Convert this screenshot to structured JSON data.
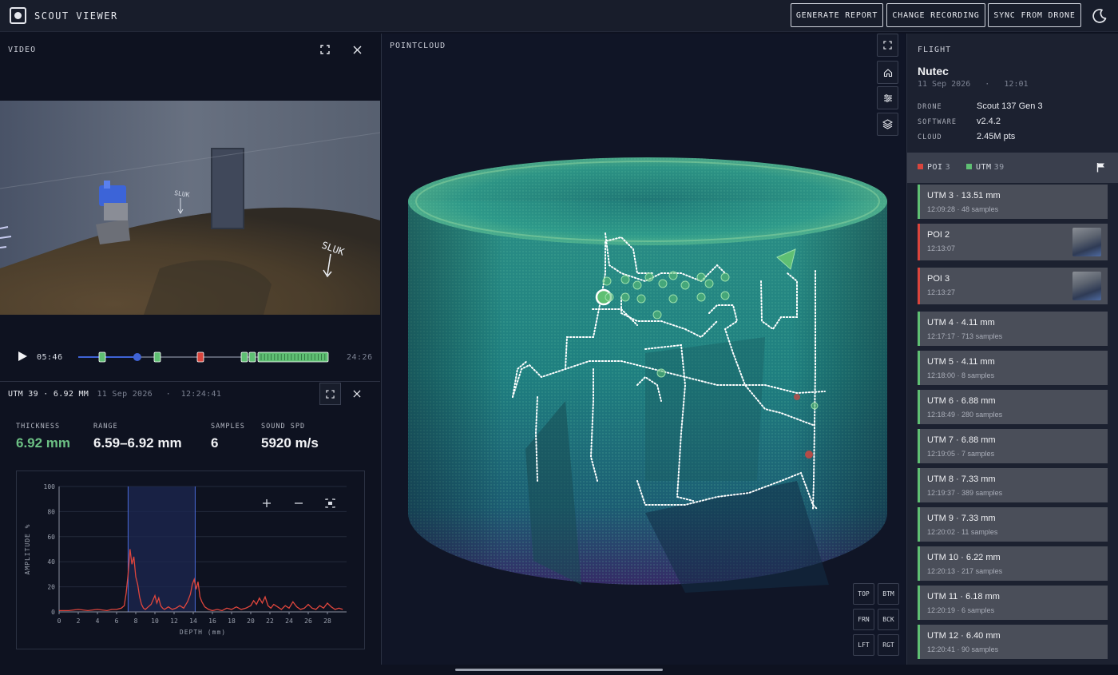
{
  "app": {
    "title": "SCOUT VIEWER"
  },
  "topbar": {
    "generate_report": "GENERATE REPORT",
    "change_recording": "CHANGE RECORDING",
    "sync_from_drone": "SYNC FROM DRONE"
  },
  "video": {
    "label": "VIDEO",
    "current_time": "05:46",
    "duration": "24:26",
    "progress": 0.236,
    "frame_text": [
      "SLUK",
      "SLUK"
    ]
  },
  "detail": {
    "title": "UTM 39 · 6.92 MM",
    "date": "11 Sep 2026",
    "time": "12:24:41",
    "stats": [
      {
        "label": "THICKNESS",
        "value": "6.92 mm"
      },
      {
        "label": "RANGE",
        "value": "6.59–6.92 mm"
      },
      {
        "label": "SAMPLES",
        "value": "6"
      },
      {
        "label": "SOUND SPD",
        "value": "5920 m/s"
      }
    ]
  },
  "pointcloud": {
    "label": "POINTCLOUD",
    "views": [
      "TOP",
      "BTM",
      "FRN",
      "BCK",
      "LFT",
      "RGT"
    ]
  },
  "flight": {
    "label": "FLIGHT",
    "name": "Nutec",
    "date": "11 Sep 2026",
    "time": "12:01",
    "info": [
      {
        "key": "DRONE",
        "value": "Scout 137 Gen 3"
      },
      {
        "key": "SOFTWARE",
        "value": "v2.4.2"
      },
      {
        "key": "CLOUD",
        "value": "2.45M pts"
      }
    ],
    "legend": {
      "poi_label": "POI",
      "poi_count": "3",
      "utm_label": "UTM",
      "utm_count": "39"
    },
    "items": [
      {
        "type": "utm",
        "title": "UTM 3 · 13.51 mm",
        "time": "12:09:28",
        "samples": "48 samples"
      },
      {
        "type": "poi",
        "title": "POI 2",
        "time": "12:13:07"
      },
      {
        "type": "poi",
        "title": "POI 3",
        "time": "12:13:27"
      },
      {
        "type": "utm",
        "title": "UTM 4 · 4.11 mm",
        "time": "12:17:17",
        "samples": "713 samples"
      },
      {
        "type": "utm",
        "title": "UTM 5 · 4.11 mm",
        "time": "12:18:00",
        "samples": "8 samples"
      },
      {
        "type": "utm",
        "title": "UTM 6 · 6.88 mm",
        "time": "12:18:49",
        "samples": "280 samples"
      },
      {
        "type": "utm",
        "title": "UTM 7 · 6.88 mm",
        "time": "12:19:05",
        "samples": "7 samples"
      },
      {
        "type": "utm",
        "title": "UTM 8 · 7.33 mm",
        "time": "12:19:37",
        "samples": "389 samples"
      },
      {
        "type": "utm",
        "title": "UTM 9 · 7.33 mm",
        "time": "12:20:02",
        "samples": "11 samples"
      },
      {
        "type": "utm",
        "title": "UTM 10 · 6.22 mm",
        "time": "12:20:13",
        "samples": "217 samples"
      },
      {
        "type": "utm",
        "title": "UTM 11 · 6.18 mm",
        "time": "12:20:19",
        "samples": "6 samples"
      },
      {
        "type": "utm",
        "title": "UTM 12 · 6.40 mm",
        "time": "12:20:41",
        "samples": "90 samples"
      }
    ]
  },
  "colors": {
    "utm": "#5fbf73",
    "poi": "#d9453d",
    "accent": "#3f63d6",
    "signal": "#e0463d",
    "thickness": "#6cc084"
  },
  "chart_data": {
    "type": "line",
    "xlabel": "DEPTH (mm)",
    "ylabel": "AMPLITUDE %",
    "xlim": [
      0,
      30
    ],
    "ylim": [
      0,
      100
    ],
    "x_ticks": [
      0,
      2,
      4,
      6,
      8,
      10,
      12,
      14,
      16,
      18,
      20,
      22,
      24,
      26,
      28
    ],
    "y_ticks": [
      0,
      20,
      40,
      60,
      80,
      100
    ],
    "gate": [
      7.2,
      14.2
    ],
    "series": [
      {
        "x": [
          0,
          1,
          2,
          3,
          4,
          5,
          5.5,
          6,
          6.5,
          6.8,
          7,
          7.2,
          7.4,
          7.6,
          7.8,
          8,
          8.2,
          8.4,
          8.6,
          8.8,
          9,
          9.3,
          9.6,
          10,
          10.2,
          10.4,
          10.6,
          10.8,
          11,
          11.4,
          11.8,
          12.2,
          12.6,
          13,
          13.4,
          13.7,
          13.9,
          14.1,
          14.3,
          14.5,
          14.7,
          14.9,
          15.2,
          15.6,
          16,
          16.5,
          17,
          17.5,
          18,
          18.5,
          19,
          19.5,
          20,
          20.3,
          20.6,
          20.9,
          21.2,
          21.5,
          21.8,
          22.1,
          22.4,
          22.8,
          23.2,
          23.6,
          24,
          24.4,
          24.8,
          25.2,
          25.6,
          26,
          26.4,
          26.8,
          27.2,
          27.6,
          28,
          28.4,
          28.8,
          29.2,
          29.6
        ],
        "y": [
          1,
          1,
          2,
          1,
          2,
          1,
          2,
          2,
          3,
          5,
          15,
          30,
          50,
          38,
          44,
          28,
          22,
          12,
          6,
          3,
          2,
          4,
          6,
          13,
          7,
          11,
          5,
          3,
          2,
          4,
          2,
          3,
          5,
          3,
          8,
          14,
          22,
          26,
          18,
          24,
          12,
          8,
          4,
          2,
          1,
          2,
          1,
          3,
          2,
          4,
          2,
          3,
          5,
          9,
          6,
          11,
          7,
          12,
          5,
          3,
          6,
          4,
          2,
          5,
          3,
          8,
          4,
          2,
          3,
          6,
          3,
          2,
          5,
          3,
          7,
          4,
          2,
          3,
          2
        ]
      }
    ]
  }
}
